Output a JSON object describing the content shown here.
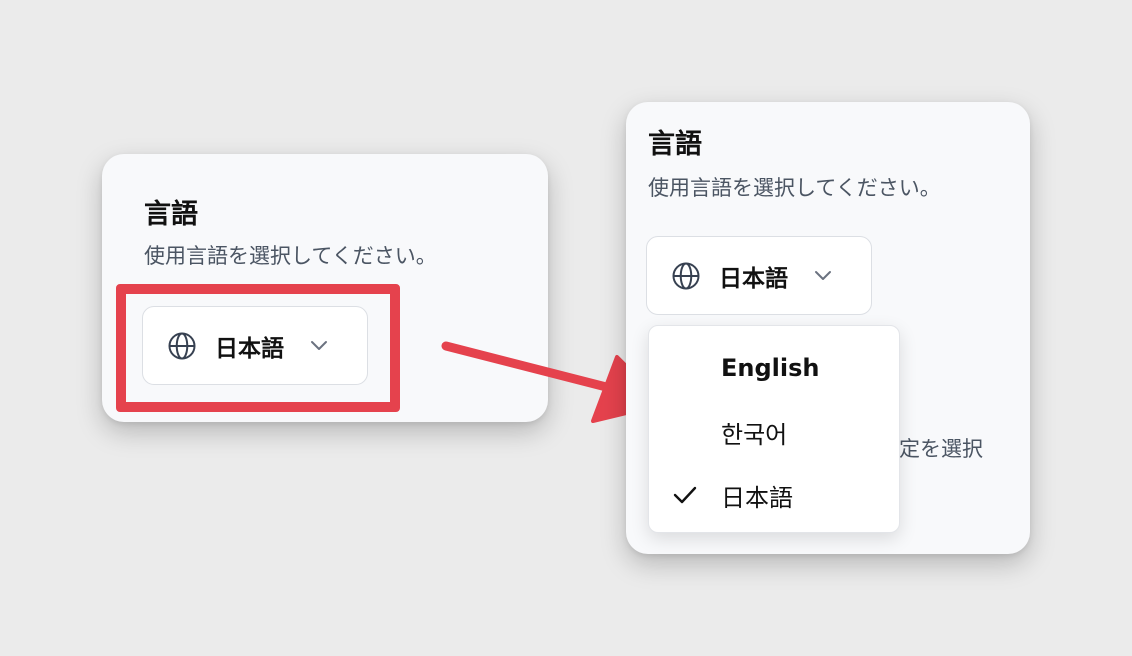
{
  "before_card": {
    "title": "言語",
    "subtitle": "使用言語を選択してください。",
    "select": {
      "icon": "globe-icon",
      "value": "日本語"
    }
  },
  "after_card": {
    "title": "言語",
    "subtitle": "使用言語を選択してください。",
    "select": {
      "icon": "globe-icon",
      "value": "日本語"
    },
    "behind_text": "設定を選択",
    "dropdown": {
      "options": [
        {
          "label": "English",
          "selected": false
        },
        {
          "label": "한국어",
          "selected": false
        },
        {
          "label": "日本語",
          "selected": true
        }
      ],
      "selected_icon": "check-icon"
    }
  },
  "annotation": {
    "highlight_color": "#e5424d",
    "arrow_color": "#e5424d"
  }
}
